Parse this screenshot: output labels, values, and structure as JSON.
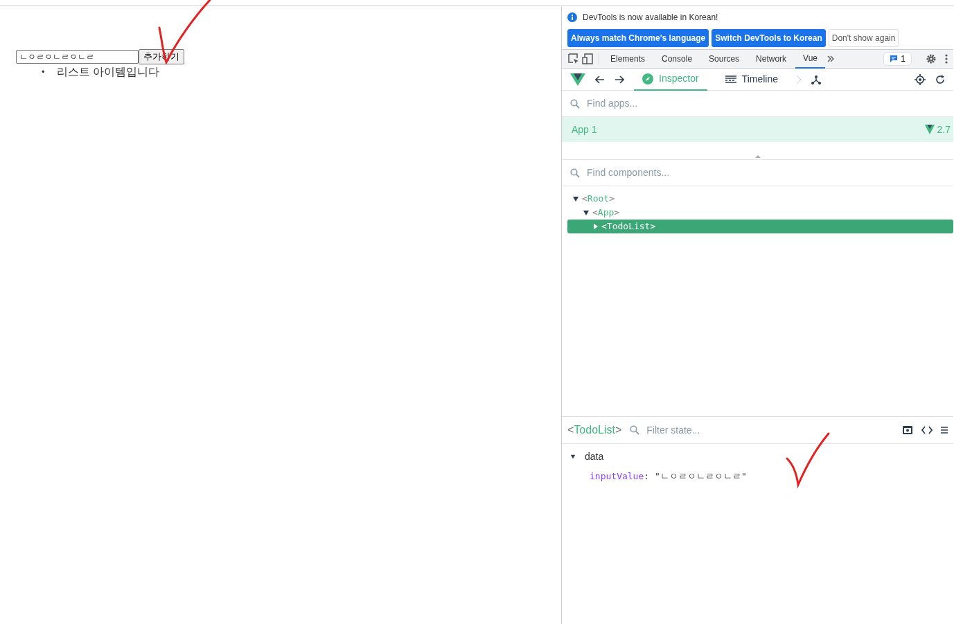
{
  "page": {
    "input_value": "ㄴㅇㄹㅇㄴㄹㅇㄴㄹ",
    "add_button": "추가하기",
    "list_items": [
      {
        "marker": "•",
        "text": "리스트 아이템입니다"
      }
    ]
  },
  "devtools": {
    "notice": {
      "text": "DevTools is now available in Korean!",
      "buttons": [
        {
          "label": "Always match Chrome's language",
          "kind": "primary"
        },
        {
          "label": "Switch DevTools to Korean",
          "kind": "primary"
        },
        {
          "label": "Don't show again",
          "kind": "outline"
        }
      ]
    },
    "tabs": [
      {
        "label": "Elements",
        "selected": false
      },
      {
        "label": "Console",
        "selected": false
      },
      {
        "label": "Sources",
        "selected": false
      },
      {
        "label": "Network",
        "selected": false
      },
      {
        "label": "Vue",
        "selected": true
      }
    ],
    "issues_count": "1",
    "vue": {
      "tabs": [
        {
          "label": "Inspector",
          "selected": true
        },
        {
          "label": "Timeline",
          "selected": false
        }
      ],
      "apps_search": {
        "placeholder": "Find apps..."
      },
      "apps": [
        {
          "name": "App 1",
          "version": "2.7",
          "selected": true
        }
      ],
      "components_search": {
        "placeholder": "Find components..."
      },
      "tree": [
        {
          "name": "<Root>",
          "expanded": true,
          "selected": false,
          "children": [
            {
              "name": "<App>",
              "expanded": true,
              "selected": false,
              "children": [
                {
                  "name": "<TodoList>",
                  "expanded": false,
                  "selected": true
                }
              ]
            }
          ]
        }
      ],
      "inspector": {
        "component": "<TodoList>",
        "filter": {
          "placeholder": "Filter state..."
        },
        "sections": [
          {
            "name": "data",
            "expanded": true,
            "fields": [
              {
                "key": "inputValue",
                "separator": ":",
                "value": "\"ㄴㅇㄹㅇㄴㄹㅇㄴㄹ\""
              }
            ]
          }
        ]
      }
    }
  }
}
